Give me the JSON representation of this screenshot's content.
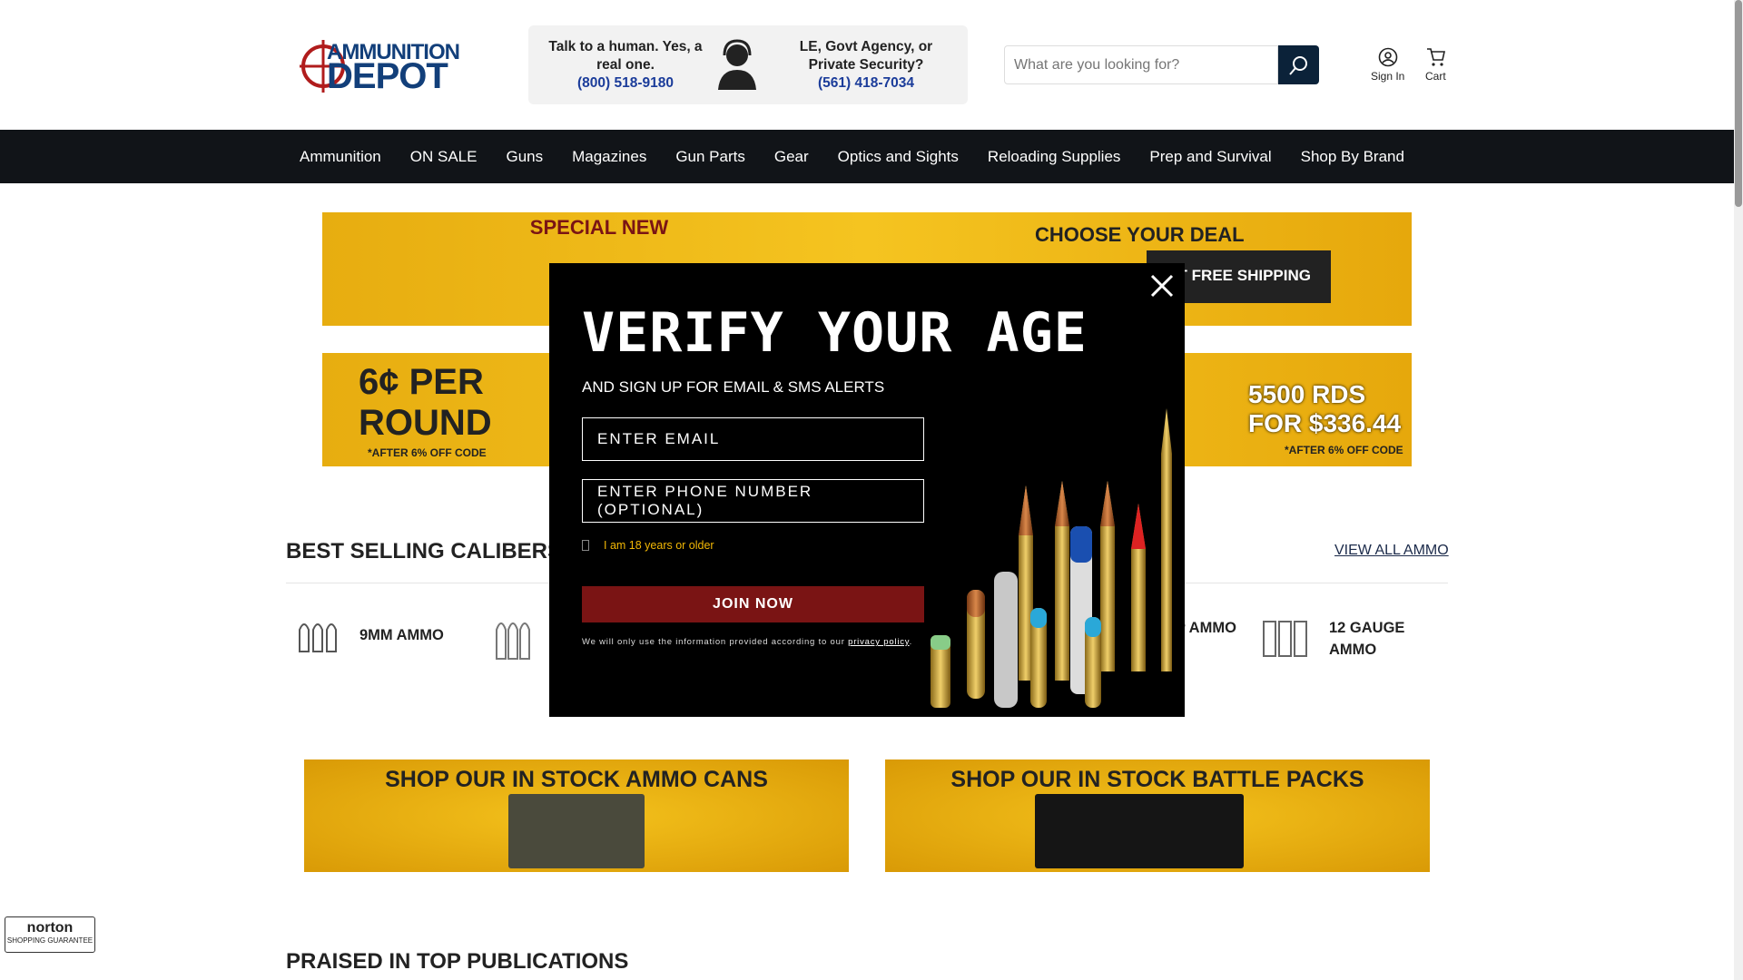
{
  "header": {
    "logo_top": "AMMUNITION",
    "logo_bottom": "DEPOT",
    "contact_left": {
      "text": "Talk to a human. Yes, a real one.",
      "phone": "(800) 518-9180"
    },
    "contact_right": {
      "text": "LE, Govt Agency, or Private Security?",
      "phone": "(561) 418-7034"
    },
    "search_placeholder": "What are you looking for?",
    "sign_in": "Sign In",
    "cart": "Cart"
  },
  "nav": [
    "Ammunition",
    "ON SALE",
    "Guns",
    "Magazines",
    "Gun Parts",
    "Gear",
    "Optics and Sights",
    "Reloading Supplies",
    "Prep and Survival",
    "Shop By Brand"
  ],
  "banners": {
    "b1_left": "SPECIAL NEW",
    "b1_right": "CHOOSE YOUR DEAL",
    "b1_ship": "GET FREE SHIPPING",
    "b2_left": "6¢ PER ROUND",
    "b2_left_note": "*AFTER 6% OFF CODE",
    "b2_right": "5500 RDS FOR $336.44",
    "b2_right_note": "*AFTER 6% OFF CODE"
  },
  "modal": {
    "title": "VERIFY YOUR AGE",
    "subtitle": "AND SIGN UP FOR EMAIL & SMS ALERTS",
    "email_placeholder": "ENTER EMAIL",
    "phone_placeholder": "ENTER PHONE NUMBER (OPTIONAL)",
    "age_label": "I am 18 years or older",
    "join": "JOIN NOW",
    "disclaimer": "We will only use the information provided according to our ",
    "privacy": "privacy policy",
    "disclaimer_end": "."
  },
  "best_selling": {
    "title": "BEST SELLING CALIBERS",
    "view_all": "VIEW ALL AMMO",
    "items": [
      "9MM AMMO",
      "P AMMO",
      "12 GAUGE AMMO"
    ]
  },
  "promos": [
    "SHOP OUR IN STOCK AMMO CANS",
    "SHOP OUR IN STOCK BATTLE PACKS"
  ],
  "praised": "PRAISED IN TOP PUBLICATIONS",
  "norton": {
    "name": "norton",
    "sub": "SHOPPING GUARANTEE"
  }
}
